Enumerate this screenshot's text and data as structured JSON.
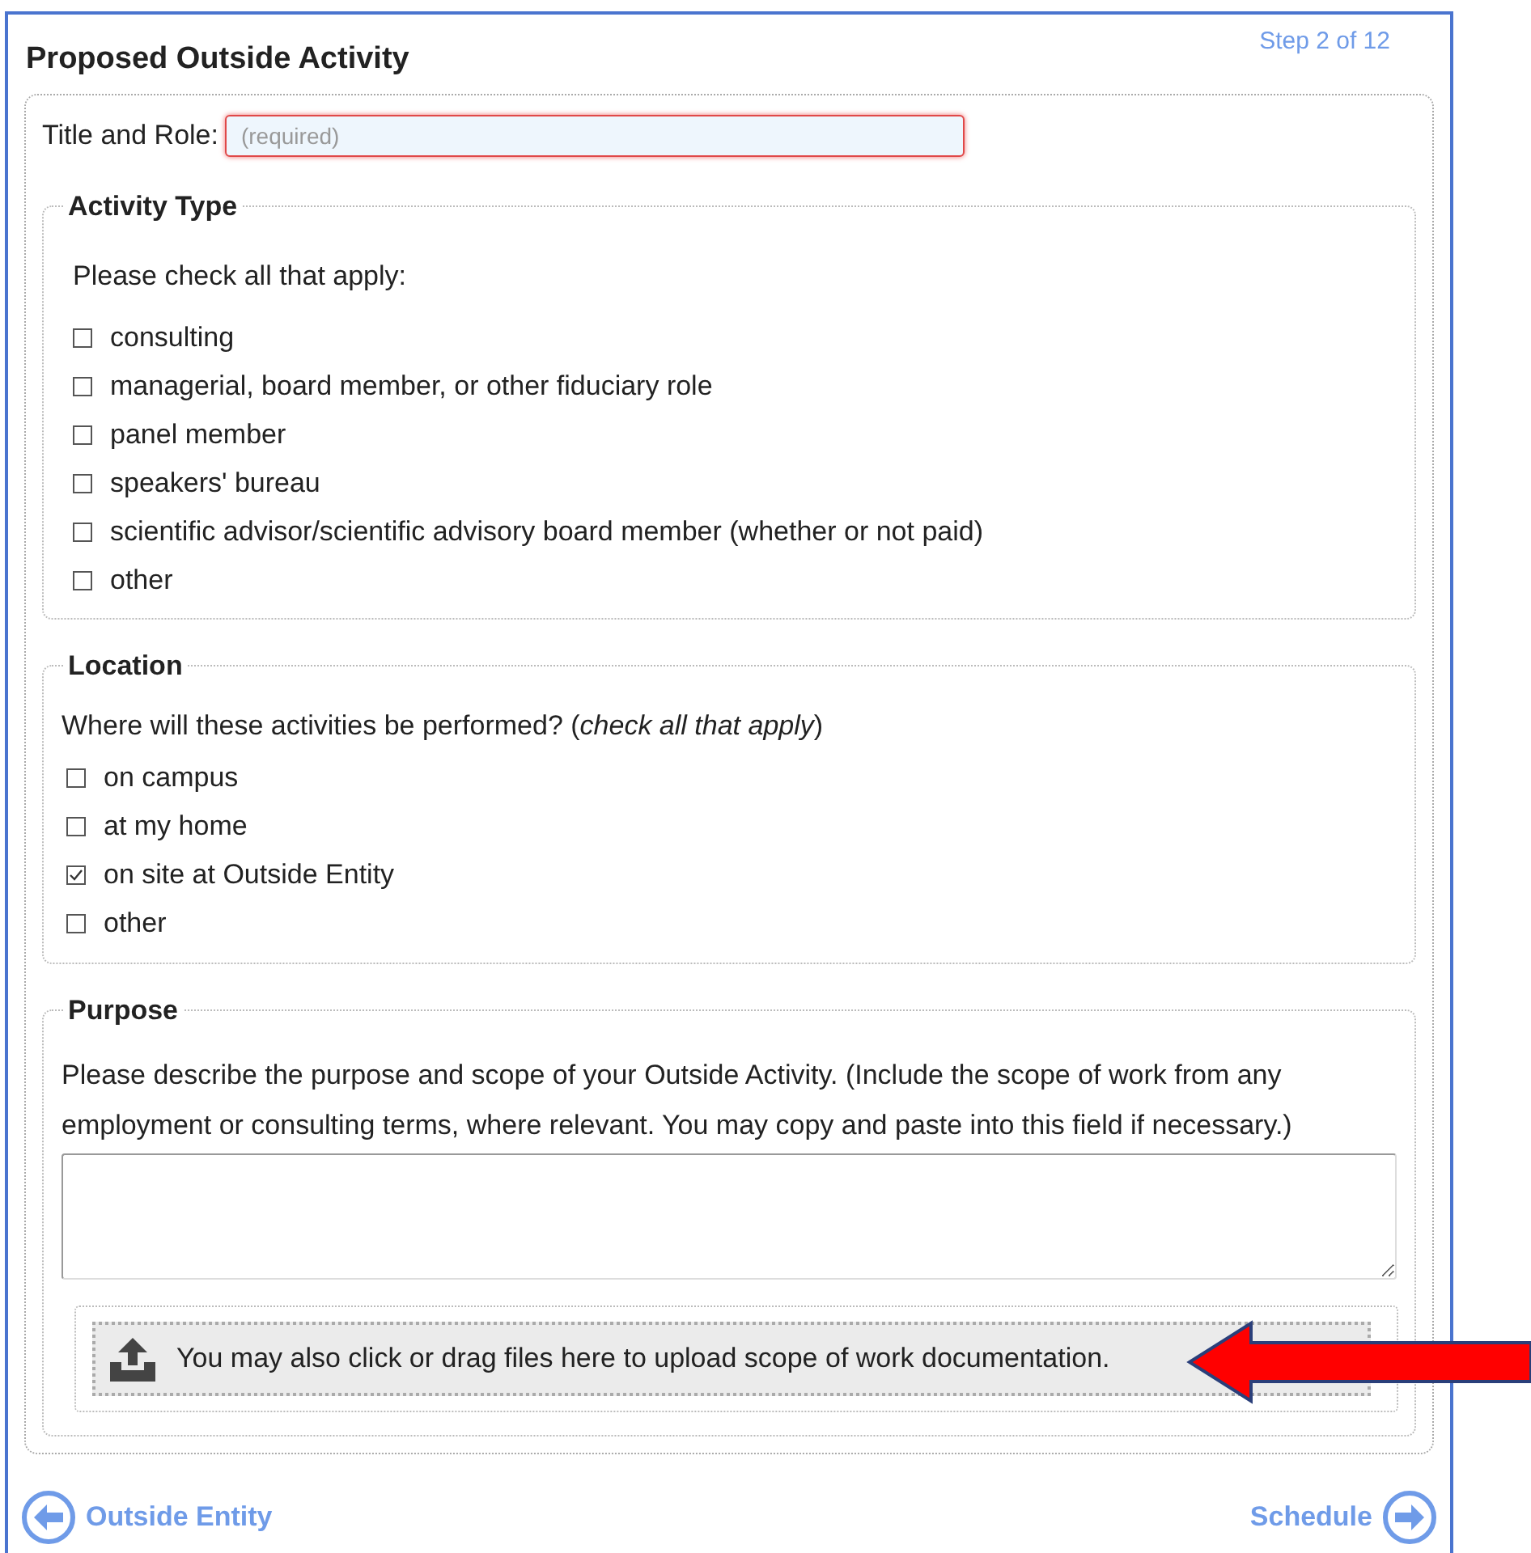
{
  "header": {
    "title": "Proposed Outside Activity",
    "step": "Step 2 of 12"
  },
  "title_role": {
    "label": "Title and Role:",
    "placeholder": "(required)",
    "invalid": true
  },
  "activity_type": {
    "legend": "Activity Type",
    "prompt": "Please check all that apply:",
    "options": [
      {
        "label": "consulting",
        "checked": false
      },
      {
        "label": "managerial, board member, or other fiduciary role",
        "checked": false
      },
      {
        "label": "panel member",
        "checked": false
      },
      {
        "label": "speakers' bureau",
        "checked": false
      },
      {
        "label": "scientific advisor/scientific advisory board member (whether or not paid)",
        "checked": false
      },
      {
        "label": "other",
        "checked": false
      }
    ]
  },
  "location": {
    "legend": "Location",
    "prompt": "Where will these activities be performed? (*check all that apply*)",
    "options": [
      {
        "label": "on campus",
        "checked": false
      },
      {
        "label": "at my home",
        "checked": false
      },
      {
        "label": "on site at Outside Entity",
        "checked": true
      },
      {
        "label": "other",
        "checked": false
      }
    ]
  },
  "purpose": {
    "legend": "Purpose",
    "prompt": "Please describe the purpose and scope of your Outside Activity. (Include the scope of work from any employment or consulting terms, where relevant. You may copy and paste into this field if necessary.)",
    "upload": "You may also click or drag files here to upload scope of work documentation."
  },
  "nav": {
    "back": "Outside Entity",
    "next": "Schedule"
  }
}
